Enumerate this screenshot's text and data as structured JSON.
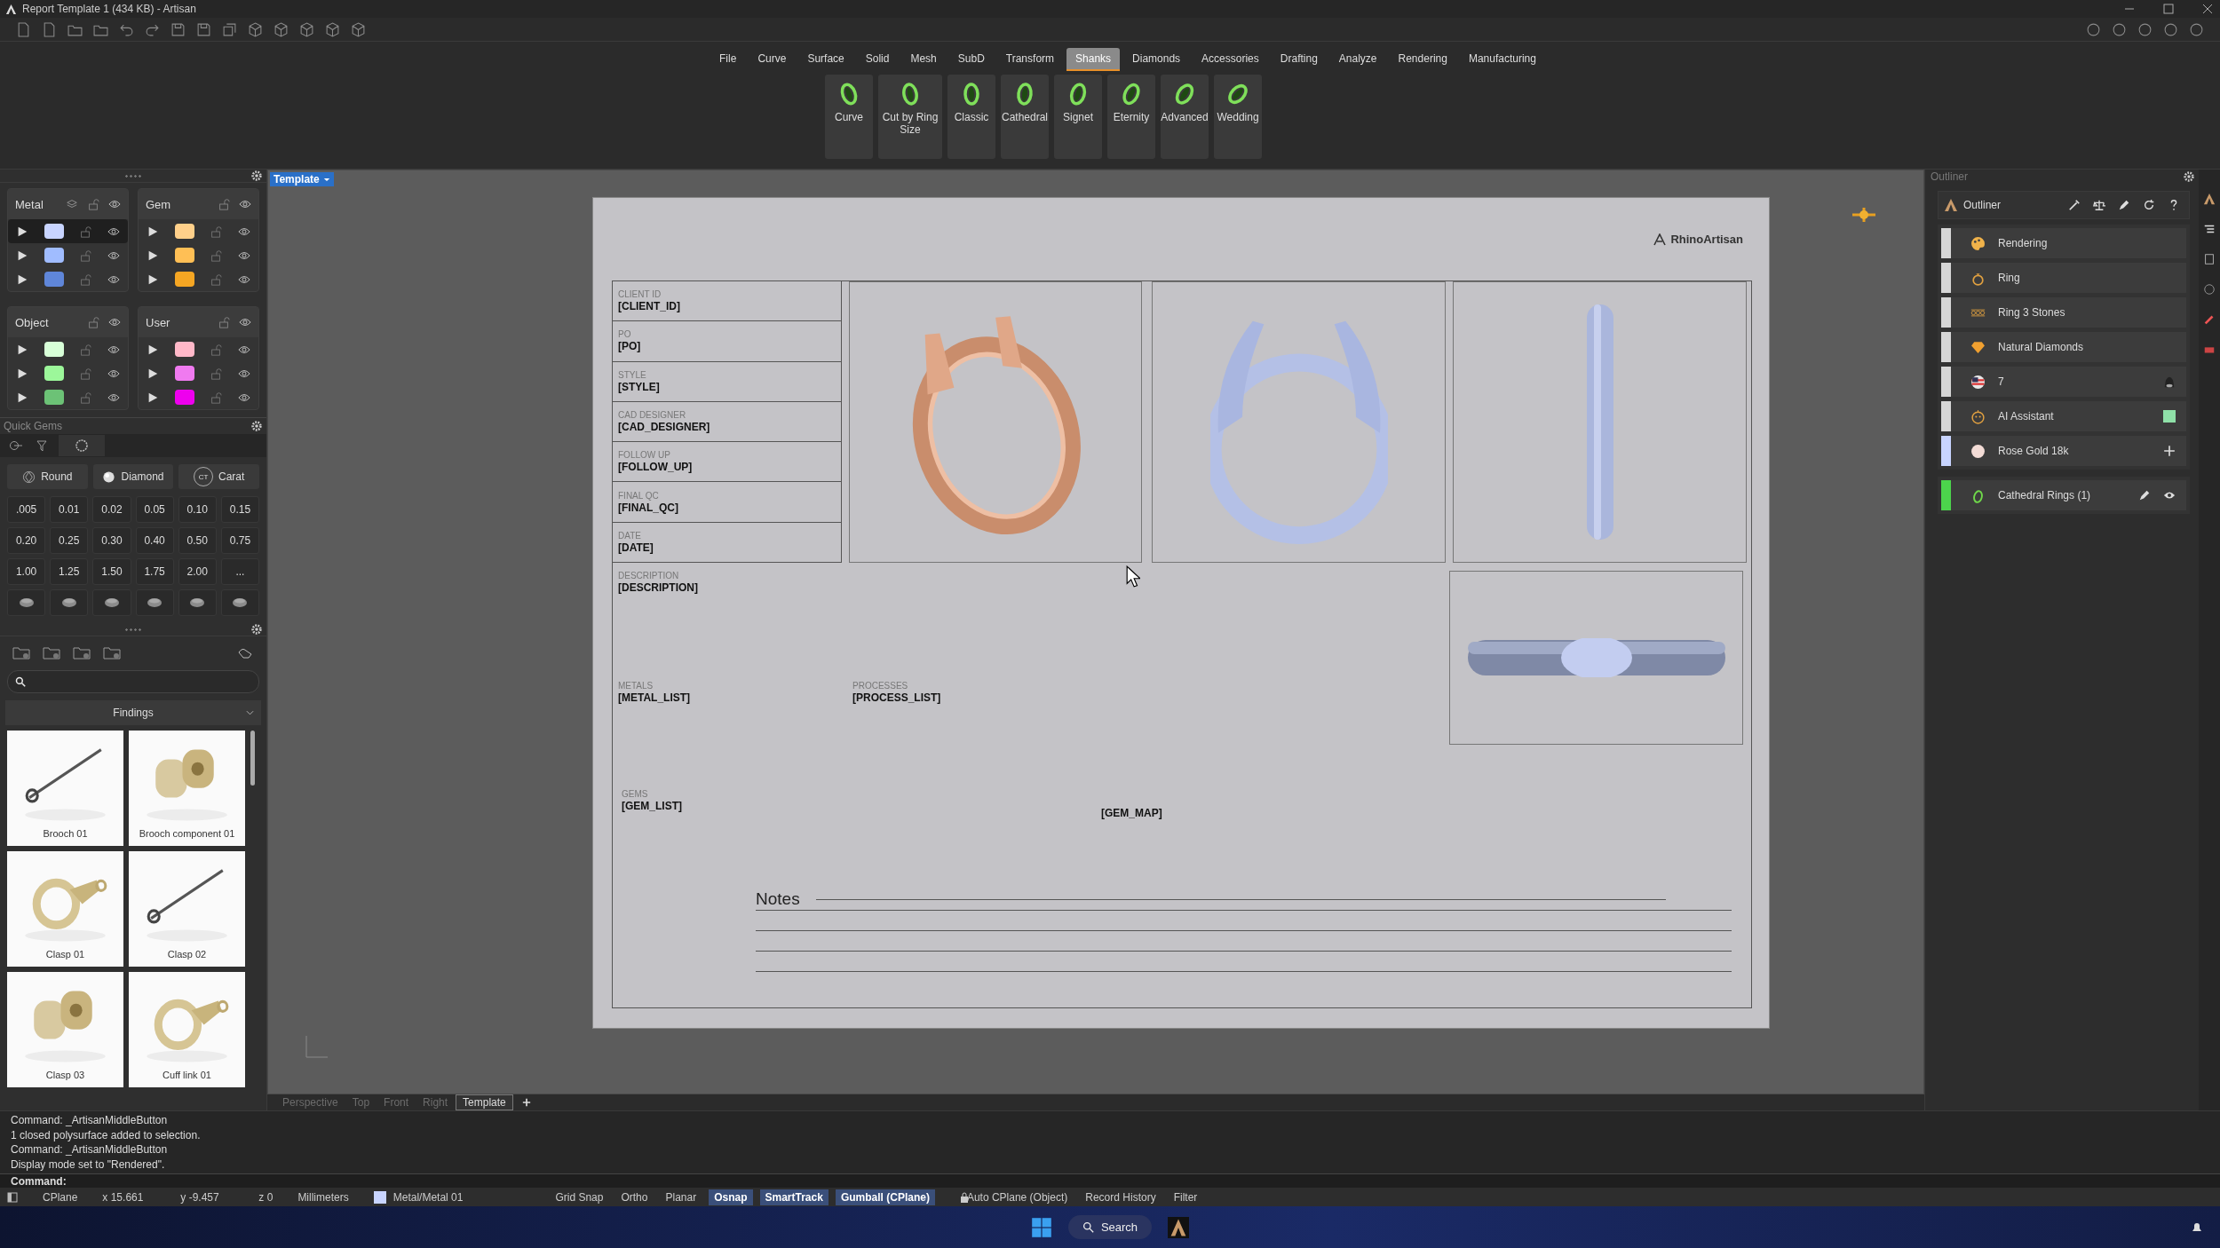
{
  "window": {
    "title": "Report Template 1 (434 KB) - Artisan"
  },
  "menu_tabs": [
    {
      "label": "File",
      "selected": false
    },
    {
      "label": "Curve",
      "selected": false
    },
    {
      "label": "Surface",
      "selected": false
    },
    {
      "label": "Solid",
      "selected": false
    },
    {
      "label": "Mesh",
      "selected": false
    },
    {
      "label": "SubD",
      "selected": false
    },
    {
      "label": "Transform",
      "selected": false
    },
    {
      "label": "Shanks",
      "selected": true
    },
    {
      "label": "Diamonds",
      "selected": false
    },
    {
      "label": "Accessories",
      "selected": false
    },
    {
      "label": "Drafting",
      "selected": false
    },
    {
      "label": "Analyze",
      "selected": false
    },
    {
      "label": "Rendering",
      "selected": false
    },
    {
      "label": "Manufacturing",
      "selected": false
    }
  ],
  "ribbon_buttons": [
    {
      "label": "Curve"
    },
    {
      "label": "Cut by Ring Size"
    },
    {
      "label": "Classic"
    },
    {
      "label": "Cathedral"
    },
    {
      "label": "Signet"
    },
    {
      "label": "Eternity"
    },
    {
      "label": "Advanced"
    },
    {
      "label": "Wedding"
    }
  ],
  "layer_groups": [
    {
      "name": "Metal",
      "rows": [
        {
          "color": "#c8d4ff",
          "selected": true
        },
        {
          "color": "#a0bcff",
          "selected": false
        },
        {
          "color": "#5f86d9",
          "selected": false
        }
      ]
    },
    {
      "name": "Gem",
      "rows": [
        {
          "color": "#ffd08a",
          "selected": false
        },
        {
          "color": "#ffbf55",
          "selected": false
        },
        {
          "color": "#f5a623",
          "selected": false
        }
      ]
    },
    {
      "name": "Object",
      "rows": [
        {
          "color": "#d8ffd8",
          "selected": false
        },
        {
          "color": "#9cf79a",
          "selected": false
        },
        {
          "color": "#6cc276",
          "selected": false
        }
      ]
    },
    {
      "name": "User",
      "rows": [
        {
          "color": "#ffb8c8",
          "selected": false
        },
        {
          "color": "#f07af0",
          "selected": false
        },
        {
          "color": "#ee00ee",
          "selected": false
        }
      ]
    }
  ],
  "quick_gems": {
    "title": "Quick Gems",
    "dropdowns": [
      {
        "label": "Round"
      },
      {
        "label": "Diamond"
      },
      {
        "label": "Carat",
        "icon_text": "CT"
      }
    ],
    "sizes": [
      ".005",
      "0.01",
      "0.02",
      "0.05",
      "0.10",
      "0.15",
      "0.20",
      "0.25",
      "0.30",
      "0.40",
      "0.50",
      "0.75",
      "1.00",
      "1.25",
      "1.50",
      "1.75",
      "2.00",
      "..."
    ]
  },
  "library": {
    "category": "Findings",
    "items": [
      {
        "label": "Brooch 01"
      },
      {
        "label": "Brooch component 01"
      },
      {
        "label": "Clasp 01"
      },
      {
        "label": "Clasp 02"
      },
      {
        "label": "Clasp 03"
      },
      {
        "label": "Cuff link 01"
      }
    ]
  },
  "viewport": {
    "label": "Template",
    "tabs": [
      {
        "label": "Perspective",
        "selected": false
      },
      {
        "label": "Top",
        "selected": false
      },
      {
        "label": "Front",
        "selected": false
      },
      {
        "label": "Right",
        "selected": false
      },
      {
        "label": "Template",
        "selected": true
      }
    ]
  },
  "template": {
    "logo": "RhinoArtisan",
    "fields": [
      {
        "label": "CLIENT ID",
        "value": "[CLIENT_ID]"
      },
      {
        "label": "PO",
        "value": "[PO]"
      },
      {
        "label": "STYLE",
        "value": "[STYLE]"
      },
      {
        "label": "CAD DESIGNER",
        "value": "[CAD_DESIGNER]"
      },
      {
        "label": "FOLLOW UP",
        "value": "[FOLLOW_UP]"
      },
      {
        "label": "FINAL QC",
        "value": "[FINAL_QC]"
      },
      {
        "label": "DATE",
        "value": "[DATE]"
      }
    ],
    "description": {
      "label": "DESCRIPTION",
      "value": "[DESCRIPTION]"
    },
    "metals": {
      "label": "METALS",
      "value": "[METAL_LIST]"
    },
    "processes": {
      "label": "PROCESSES",
      "value": "[PROCESS_LIST]"
    },
    "gems": {
      "label": "GEMS",
      "value": "[GEM_LIST]"
    },
    "gem_map": "[GEM_MAP]",
    "notes_title": "Notes"
  },
  "outliner": {
    "panel_title": "Outliner",
    "title": "Outliner",
    "items": [
      {
        "label": "Rendering",
        "color": "#d6d6d6"
      },
      {
        "label": "Ring",
        "color": "#d6d6d6"
      },
      {
        "label": "Ring 3 Stones",
        "color": "#d6d6d6"
      },
      {
        "label": "Natural Diamonds",
        "color": "#d6d6d6"
      },
      {
        "label": "7",
        "color": "#d6d6d6"
      },
      {
        "label": "AI Assistant",
        "color": "#d6d6d6"
      },
      {
        "label": "Rose Gold 18k",
        "color": "#c8d4ff"
      }
    ],
    "collection": {
      "label": "Cathedral Rings (1)",
      "color": "#4cd44c"
    }
  },
  "command": {
    "history": [
      "Command: _ArtisanMiddleButton",
      "1 closed polysurface added to selection.",
      "Command: _ArtisanMiddleButton",
      "Display mode set to \"Rendered\"."
    ],
    "prompt": "Command:"
  },
  "status_bar": {
    "cplane": "CPlane",
    "x": "x 15.661",
    "y": "y -9.457",
    "z": "z 0",
    "units": "Millimeters",
    "layer": {
      "label": "Metal/Metal 01",
      "color": "#c8d4ff"
    },
    "toggles": [
      {
        "label": "Grid Snap",
        "on": false,
        "kind": "plain"
      },
      {
        "label": "Ortho",
        "on": false,
        "kind": "plain"
      },
      {
        "label": "Planar",
        "on": false,
        "kind": "plain"
      },
      {
        "label": "Osnap",
        "on": true,
        "kind": "plain"
      },
      {
        "label": "SmartTrack",
        "on": true,
        "kind": "plain"
      },
      {
        "label": "Gumball (CPlane)",
        "on": true,
        "kind": "plain"
      },
      {
        "label": "Auto CPlane (Object)",
        "on": false,
        "kind": "lock"
      },
      {
        "label": "Record History",
        "on": false,
        "kind": "plain"
      },
      {
        "label": "Filter",
        "on": false,
        "kind": "plain"
      }
    ]
  },
  "taskbar": {
    "search": "Search"
  }
}
